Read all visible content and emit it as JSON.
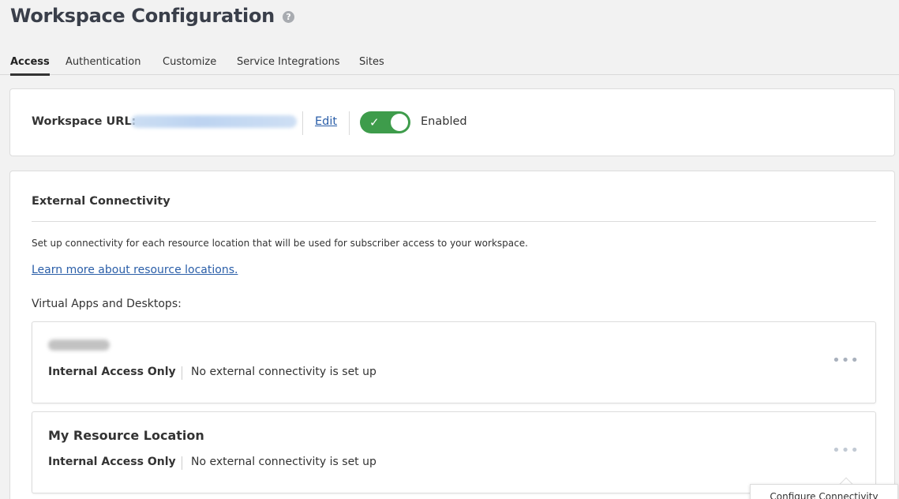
{
  "header": {
    "title": "Workspace Configuration",
    "help_icon": "?"
  },
  "tabs": [
    {
      "label": "Access",
      "active": true
    },
    {
      "label": "Authentication",
      "active": false
    },
    {
      "label": "Customize",
      "active": false
    },
    {
      "label": "Service Integrations",
      "active": false
    },
    {
      "label": "Sites",
      "active": false
    }
  ],
  "workspace_url": {
    "label": "Workspace URL:",
    "edit_label": "Edit",
    "toggle_state": "on",
    "toggle_check": "✓",
    "status_label": "Enabled",
    "toggle_color": "#3e9c4b"
  },
  "external_connectivity": {
    "title": "External Connectivity",
    "description": "Set up connectivity for each resource location that will be used for subscriber access to your workspace.",
    "learn_more_link": "Learn more about resource locations.",
    "section_label": "Virtual Apps and Desktops:",
    "locations": [
      {
        "name": "",
        "access": "Internal Access Only",
        "connectivity": "No external connectivity is set up",
        "more_icon": "•••"
      },
      {
        "name": "My Resource Location",
        "access": "Internal Access Only",
        "connectivity": "No external connectivity is set up",
        "more_icon": "•••"
      }
    ]
  },
  "tooltip": {
    "label": "Configure Connectivity"
  },
  "colors": {
    "link": "#2a5ea8",
    "background": "#f2f2f2"
  }
}
